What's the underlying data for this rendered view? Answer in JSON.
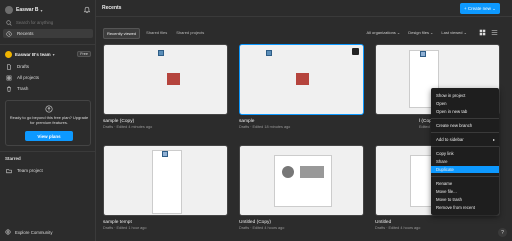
{
  "sidebar": {
    "user_name": "Easwar B",
    "search_placeholder": "Search for anything",
    "nav": [
      {
        "label": "Recents"
      },
      {
        "label": "Drafts"
      },
      {
        "label": "All projects"
      },
      {
        "label": "Trash"
      }
    ],
    "team_name": "Easwar B's team",
    "free_badge": "Free",
    "promo_text": "Ready to go beyond this free plan? Upgrade for premium features.",
    "promo_button": "View plans",
    "starred_label": "Starred",
    "starred_item": "Team project",
    "explore": "Explore Community"
  },
  "header": {
    "title": "Recents",
    "create_button": "+ Create new ⌄"
  },
  "tabs": [
    {
      "label": "Recently viewed"
    },
    {
      "label": "Shared files"
    },
    {
      "label": "Shared projects"
    }
  ],
  "filters": {
    "org": "All organizations ⌄",
    "type": "Design files ⌄",
    "sort": "Last viewed ⌄"
  },
  "files": [
    {
      "title": "sample (Copy)",
      "location": "Drafts",
      "edited": "Edited 4 minutes ago"
    },
    {
      "title": "sample",
      "location": "Drafts",
      "edited": "Edited 18 minutes ago"
    },
    {
      "title": "l (Copy)",
      "location": "Drafts",
      "edited": "Edited 1 hour ago"
    },
    {
      "title": "sample tempt",
      "location": "Drafts",
      "edited": "Edited 1 hour ago"
    },
    {
      "title": "Untitled (Copy)",
      "location": "Drafts",
      "edited": "Edited 4 hours ago"
    },
    {
      "title": "Untitled",
      "location": "Drafts",
      "edited": "Edited 4 hours ago"
    }
  ],
  "context_menu": {
    "show_in_project": "Show in project",
    "open": "Open",
    "open_new_tab": "Open in new tab",
    "create_branch": "Create new branch",
    "add_to_sidebar": "Add to sidebar",
    "add_arrow": "▸",
    "copy_link": "Copy link",
    "share": "Share",
    "duplicate": "Duplicate",
    "rename": "Rename",
    "move_file": "Move file...",
    "move_to_trash": "Move to trash",
    "remove_recent": "Remove from recent"
  },
  "help": "?"
}
